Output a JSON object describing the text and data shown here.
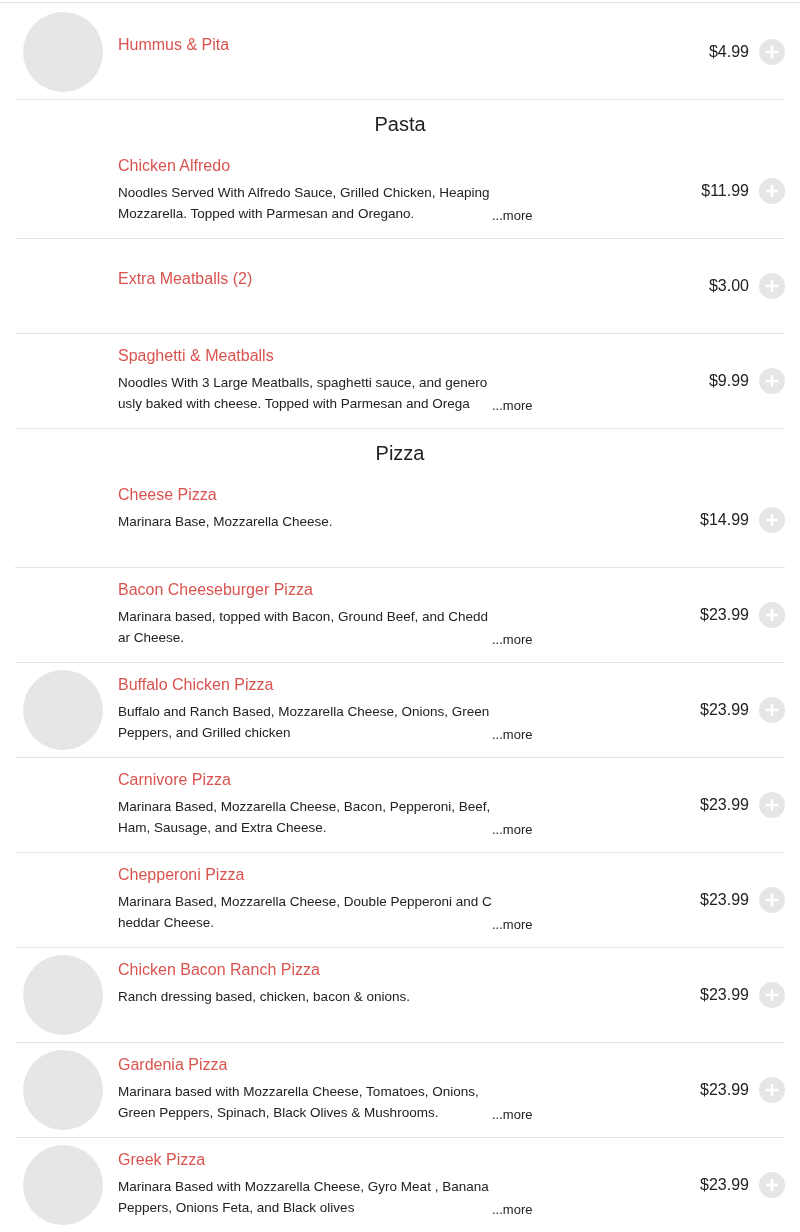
{
  "menu": [
    {
      "kind": "item",
      "name": "Hummus & Pita",
      "price": "$4.99",
      "has_image": true
    },
    {
      "kind": "header",
      "title": "Pasta"
    },
    {
      "kind": "item",
      "name": "Chicken Alfredo",
      "description": "Noodles Served With Alfredo Sauce, Grilled Chicken, Heaping Mozzarella. Topped with Parmesan and Oregano.",
      "more": "...more",
      "price": "$11.99",
      "has_image": false
    },
    {
      "kind": "item",
      "name": "Extra Meatballs (2)",
      "price": "$3.00",
      "has_image": false
    },
    {
      "kind": "item",
      "name": "Spaghetti & Meatballs",
      "description": "Noodles With 3 Large Meatballs, spaghetti sauce, and generously baked with cheese. Topped with Parmesan and Orega",
      "more": "...more",
      "price": "$9.99",
      "has_image": false
    },
    {
      "kind": "header",
      "title": "Pizza"
    },
    {
      "kind": "item",
      "name": "Cheese Pizza",
      "description": "Marinara Base, Mozzarella Cheese.",
      "price": "$14.99",
      "has_image": false
    },
    {
      "kind": "item",
      "name": "Bacon Cheeseburger Pizza",
      "description": "Marinara based, topped with Bacon, Ground Beef, and Cheddar Cheese.",
      "more": "...more",
      "price": "$23.99",
      "has_image": false
    },
    {
      "kind": "item",
      "name": "Buffalo Chicken Pizza",
      "description": "Buffalo and Ranch Based, Mozzarella Cheese, Onions, Green Peppers, and Grilled chicken",
      "more": "...more",
      "price": "$23.99",
      "has_image": true
    },
    {
      "kind": "item",
      "name": "Carnivore Pizza",
      "description": "Marinara Based, Mozzarella Cheese, Bacon, Pepperoni, Beef, Ham, Sausage, and Extra Cheese.",
      "more": "...more",
      "price": "$23.99",
      "has_image": false
    },
    {
      "kind": "item",
      "name": "Chepperoni Pizza",
      "description": "Marinara Based, Mozzarella Cheese, Double Pepperoni and Cheddar Cheese.",
      "more": "...more",
      "price": "$23.99",
      "has_image": false
    },
    {
      "kind": "item",
      "name": "Chicken Bacon Ranch Pizza",
      "description": "Ranch dressing based, chicken, bacon & onions.",
      "price": "$23.99",
      "has_image": true
    },
    {
      "kind": "item",
      "name": "Gardenia Pizza",
      "description": "Marinara based with Mozzarella Cheese, Tomatoes, Onions, Green Peppers, Spinach, Black Olives & Mushrooms.",
      "more": "...more",
      "price": "$23.99",
      "has_image": true
    },
    {
      "kind": "item",
      "name": "Greek Pizza",
      "description": "Marinara Based with Mozzarella Cheese, Gyro Meat , Banana Peppers, Onions Feta, and Black olives",
      "more": "...more",
      "price": "$23.99",
      "has_image": true
    }
  ]
}
